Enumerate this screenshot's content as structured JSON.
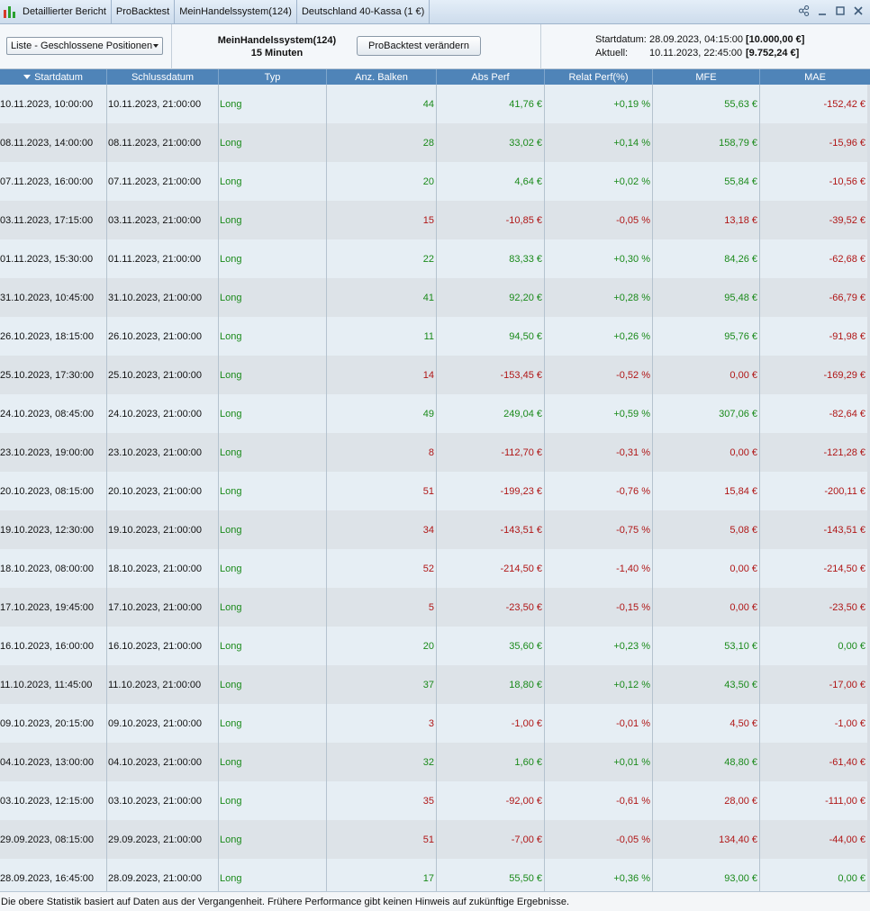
{
  "titlebar": {
    "tabs": [
      "Detaillierter Bericht",
      "ProBacktest",
      "MeinHandelssystem(124)",
      "Deutschland 40-Kassa (1 €)"
    ],
    "controls": [
      "share-icon",
      "minimize-icon",
      "maximize-icon",
      "close-icon"
    ]
  },
  "toolbar": {
    "view_select": "Liste - Geschlossene Positionen",
    "system_name": "MeinHandelssystem(124)",
    "timeframe": "15 Minuten",
    "change_button": "ProBacktest verändern",
    "start_label": "Startdatum:",
    "start_value": "28.09.2023, 04:15:00",
    "start_amount": "[10.000,00 €]",
    "current_label": "Aktuell:",
    "current_value": "10.11.2023, 22:45:00",
    "current_amount": "[9.752,24 €]"
  },
  "table": {
    "headers": [
      "Startdatum",
      "Schlussdatum",
      "Typ",
      "Anz. Balken",
      "Abs Perf",
      "Relat Perf(%)",
      "MFE",
      "MAE"
    ],
    "sorted_column": "Startdatum",
    "colors": {
      "positive": "#1a8a1a",
      "negative": "#b01616"
    },
    "rows": [
      {
        "start": "10.11.2023, 10:00:00",
        "end": "10.11.2023, 21:00:00",
        "typ": "Long",
        "bars": "44",
        "abs": "41,76 €",
        "rel": "+0,19 %",
        "mfe": "55,63 €",
        "mae": "-152,42 €",
        "pos": true,
        "mfe_pos": true
      },
      {
        "start": "08.11.2023, 14:00:00",
        "end": "08.11.2023, 21:00:00",
        "typ": "Long",
        "bars": "28",
        "abs": "33,02 €",
        "rel": "+0,14 %",
        "mfe": "158,79 €",
        "mae": "-15,96 €",
        "pos": true,
        "mfe_pos": true
      },
      {
        "start": "07.11.2023, 16:00:00",
        "end": "07.11.2023, 21:00:00",
        "typ": "Long",
        "bars": "20",
        "abs": "4,64 €",
        "rel": "+0,02 %",
        "mfe": "55,84 €",
        "mae": "-10,56 €",
        "pos": true,
        "mfe_pos": true
      },
      {
        "start": "03.11.2023, 17:15:00",
        "end": "03.11.2023, 21:00:00",
        "typ": "Long",
        "bars": "15",
        "abs": "-10,85 €",
        "rel": "-0,05 %",
        "mfe": "13,18 €",
        "mae": "-39,52 €",
        "pos": false,
        "mfe_pos": false
      },
      {
        "start": "01.11.2023, 15:30:00",
        "end": "01.11.2023, 21:00:00",
        "typ": "Long",
        "bars": "22",
        "abs": "83,33 €",
        "rel": "+0,30 %",
        "mfe": "84,26 €",
        "mae": "-62,68 €",
        "pos": true,
        "mfe_pos": true
      },
      {
        "start": "31.10.2023, 10:45:00",
        "end": "31.10.2023, 21:00:00",
        "typ": "Long",
        "bars": "41",
        "abs": "92,20 €",
        "rel": "+0,28 %",
        "mfe": "95,48 €",
        "mae": "-66,79 €",
        "pos": true,
        "mfe_pos": true
      },
      {
        "start": "26.10.2023, 18:15:00",
        "end": "26.10.2023, 21:00:00",
        "typ": "Long",
        "bars": "11",
        "abs": "94,50 €",
        "rel": "+0,26 %",
        "mfe": "95,76 €",
        "mae": "-91,98 €",
        "pos": true,
        "mfe_pos": true
      },
      {
        "start": "25.10.2023, 17:30:00",
        "end": "25.10.2023, 21:00:00",
        "typ": "Long",
        "bars": "14",
        "abs": "-153,45 €",
        "rel": "-0,52 %",
        "mfe": "0,00 €",
        "mae": "-169,29 €",
        "pos": false,
        "mfe_pos": false
      },
      {
        "start": "24.10.2023, 08:45:00",
        "end": "24.10.2023, 21:00:00",
        "typ": "Long",
        "bars": "49",
        "abs": "249,04 €",
        "rel": "+0,59 %",
        "mfe": "307,06 €",
        "mae": "-82,64 €",
        "pos": true,
        "mfe_pos": true
      },
      {
        "start": "23.10.2023, 19:00:00",
        "end": "23.10.2023, 21:00:00",
        "typ": "Long",
        "bars": "8",
        "abs": "-112,70 €",
        "rel": "-0,31 %",
        "mfe": "0,00 €",
        "mae": "-121,28 €",
        "pos": false,
        "mfe_pos": false
      },
      {
        "start": "20.10.2023, 08:15:00",
        "end": "20.10.2023, 21:00:00",
        "typ": "Long",
        "bars": "51",
        "abs": "-199,23 €",
        "rel": "-0,76 %",
        "mfe": "15,84 €",
        "mae": "-200,11 €",
        "pos": false,
        "mfe_pos": false
      },
      {
        "start": "19.10.2023, 12:30:00",
        "end": "19.10.2023, 21:00:00",
        "typ": "Long",
        "bars": "34",
        "abs": "-143,51 €",
        "rel": "-0,75 %",
        "mfe": "5,08 €",
        "mae": "-143,51 €",
        "pos": false,
        "mfe_pos": false
      },
      {
        "start": "18.10.2023, 08:00:00",
        "end": "18.10.2023, 21:00:00",
        "typ": "Long",
        "bars": "52",
        "abs": "-214,50 €",
        "rel": "-1,40 %",
        "mfe": "0,00 €",
        "mae": "-214,50 €",
        "pos": false,
        "mfe_pos": false
      },
      {
        "start": "17.10.2023, 19:45:00",
        "end": "17.10.2023, 21:00:00",
        "typ": "Long",
        "bars": "5",
        "abs": "-23,50 €",
        "rel": "-0,15 %",
        "mfe": "0,00 €",
        "mae": "-23,50 €",
        "pos": false,
        "mfe_pos": false
      },
      {
        "start": "16.10.2023, 16:00:00",
        "end": "16.10.2023, 21:00:00",
        "typ": "Long",
        "bars": "20",
        "abs": "35,60 €",
        "rel": "+0,23 %",
        "mfe": "53,10 €",
        "mae": "0,00 €",
        "pos": true,
        "mfe_pos": true
      },
      {
        "start": "11.10.2023, 11:45:00",
        "end": "11.10.2023, 21:00:00",
        "typ": "Long",
        "bars": "37",
        "abs": "18,80 €",
        "rel": "+0,12 %",
        "mfe": "43,50 €",
        "mae": "-17,00 €",
        "pos": true,
        "mfe_pos": true
      },
      {
        "start": "09.10.2023, 20:15:00",
        "end": "09.10.2023, 21:00:00",
        "typ": "Long",
        "bars": "3",
        "abs": "-1,00 €",
        "rel": "-0,01 %",
        "mfe": "4,50 €",
        "mae": "-1,00 €",
        "pos": false,
        "mfe_pos": false
      },
      {
        "start": "04.10.2023, 13:00:00",
        "end": "04.10.2023, 21:00:00",
        "typ": "Long",
        "bars": "32",
        "abs": "1,60 €",
        "rel": "+0,01 %",
        "mfe": "48,80 €",
        "mae": "-61,40 €",
        "pos": true,
        "mfe_pos": true
      },
      {
        "start": "03.10.2023, 12:15:00",
        "end": "03.10.2023, 21:00:00",
        "typ": "Long",
        "bars": "35",
        "abs": "-92,00 €",
        "rel": "-0,61 %",
        "mfe": "28,00 €",
        "mae": "-111,00 €",
        "pos": false,
        "mfe_pos": false
      },
      {
        "start": "29.09.2023, 08:15:00",
        "end": "29.09.2023, 21:00:00",
        "typ": "Long",
        "bars": "51",
        "abs": "-7,00 €",
        "rel": "-0,05 %",
        "mfe": "134,40 €",
        "mae": "-44,00 €",
        "pos": false,
        "mfe_pos": false
      },
      {
        "start": "28.09.2023, 16:45:00",
        "end": "28.09.2023, 21:00:00",
        "typ": "Long",
        "bars": "17",
        "abs": "55,50 €",
        "rel": "+0,36 %",
        "mfe": "93,00 €",
        "mae": "0,00 €",
        "pos": true,
        "mfe_pos": true
      }
    ]
  },
  "footer": {
    "text": "Die obere Statistik basiert auf Daten aus der Vergangenheit. Frühere Performance gibt keinen Hinweis auf zukünftige Ergebnisse."
  }
}
